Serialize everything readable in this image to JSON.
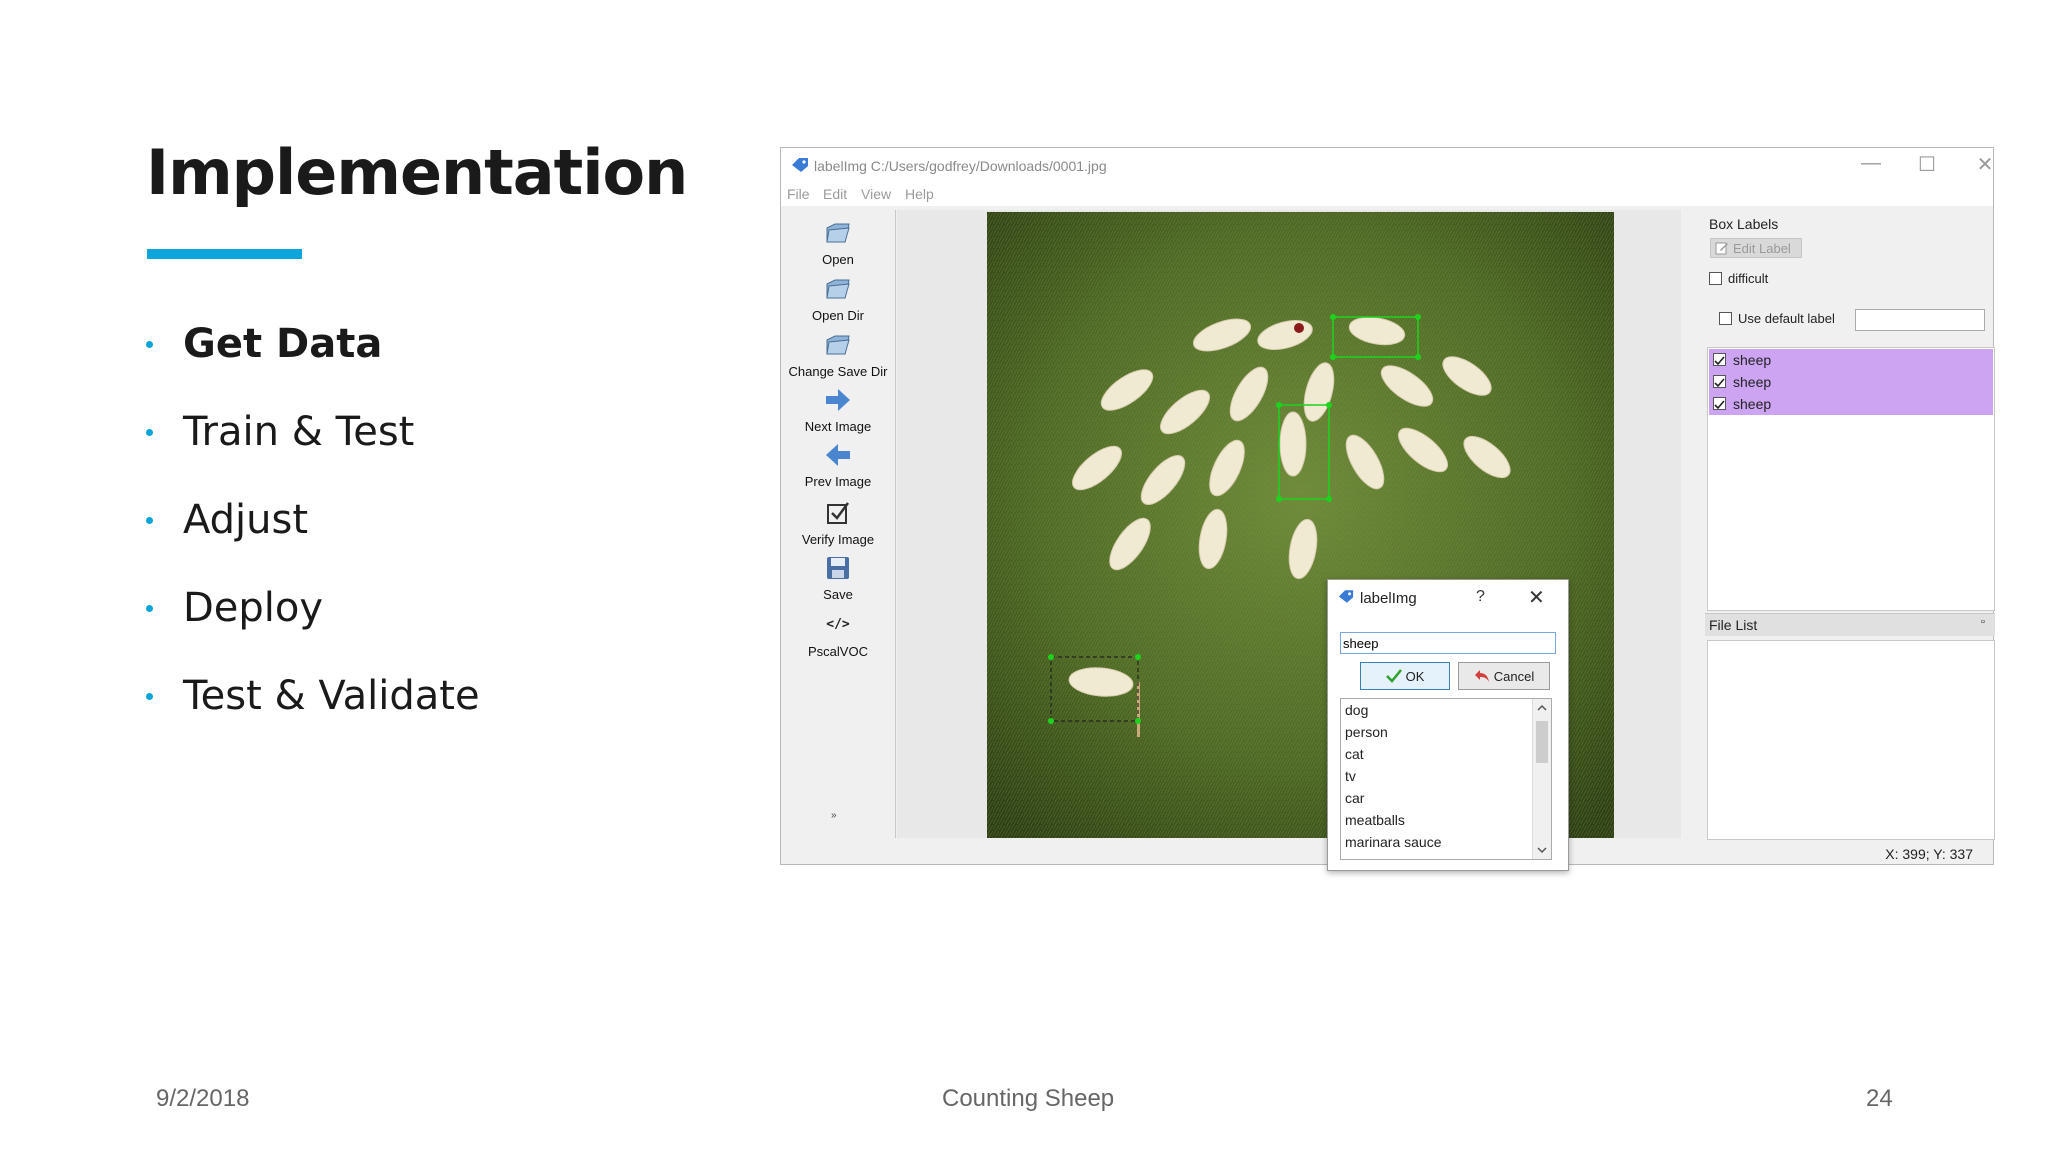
{
  "slide": {
    "title": "Implementation",
    "bullets": [
      "Get Data",
      "Train & Test",
      "Adjust",
      "Deploy",
      "Test & Validate"
    ],
    "footer_date": "9/2/2018",
    "footer_title": "Counting Sheep",
    "page_number": "24",
    "accent_color": "#0ea5dd"
  },
  "window": {
    "title": "labelImg C:/Users/godfrey/Downloads/0001.jpg",
    "controls": {
      "minimize": "—",
      "maximize": "☐",
      "close": "✕"
    },
    "menu": [
      "File",
      "Edit",
      "View",
      "Help"
    ],
    "toolbar": [
      "Open",
      "Open Dir",
      "Change Save Dir",
      "Next Image",
      "Prev Image",
      "Verify Image",
      "Save",
      "PscalVOC"
    ],
    "pascal_icon": "</>",
    "more_glyph": "»"
  },
  "dialog": {
    "title": "labelImg",
    "help": "?",
    "close": "✕",
    "input_value": "sheep",
    "ok_label": "OK",
    "cancel_label": "Cancel",
    "options": [
      "dog",
      "person",
      "cat",
      "tv",
      "car",
      "meatballs",
      "marinara sauce"
    ]
  },
  "box_labels": {
    "title": "Box Labels",
    "edit_label": "Edit Label",
    "difficult": "difficult",
    "use_default_label": "Use default label",
    "labels": [
      "sheep",
      "sheep",
      "sheep"
    ],
    "highlight_color": "#cca4f2"
  },
  "file_list": {
    "title": "File List",
    "float_icon": "▫"
  },
  "status": "X: 399; Y: 337"
}
